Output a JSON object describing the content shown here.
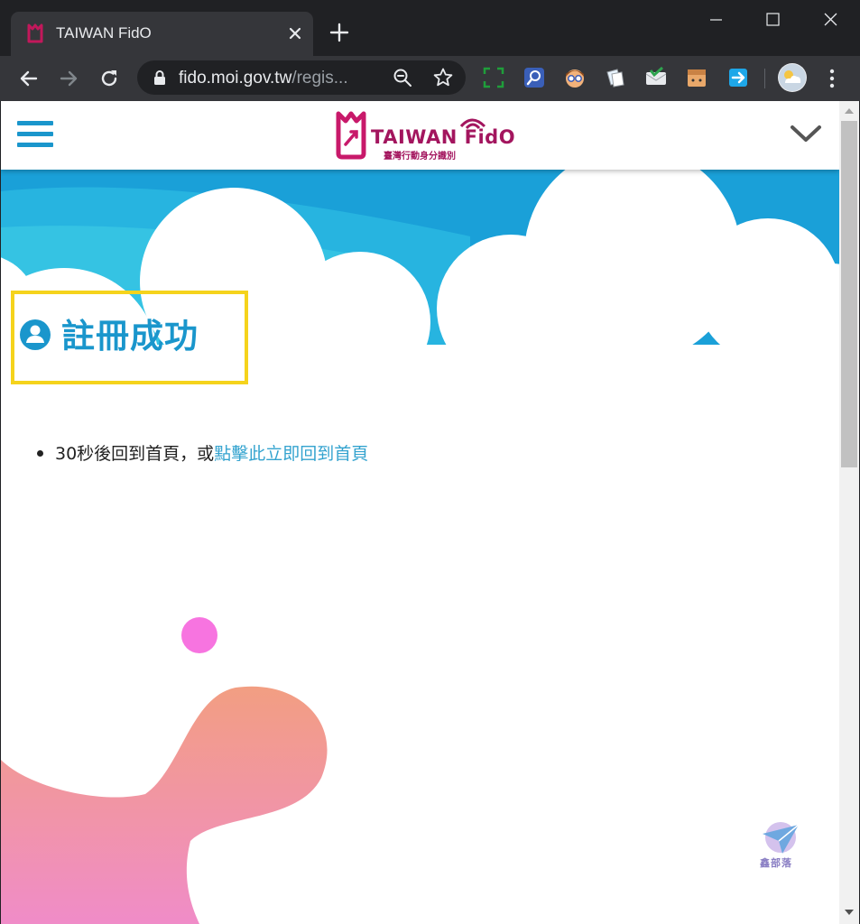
{
  "browser": {
    "tab": {
      "title": "TAIWAN FidO"
    },
    "url": {
      "host": "fido.moi.gov.tw",
      "path": "/regis..."
    },
    "extensions": [
      "screen-capture-extension-icon",
      "magnifier-extension-icon",
      "avatar-extension-icon",
      "notes-extension-icon",
      "mail-checker-extension-icon",
      "box-extension-icon",
      "send-extension-icon"
    ]
  },
  "site": {
    "logo": {
      "name": "TAIWAN FidO",
      "subtitle": "臺灣行動身分識別"
    }
  },
  "main": {
    "heading": "註冊成功",
    "message": {
      "text": "30秒後回到首頁，或",
      "link": "點擊此立即回到首頁"
    }
  },
  "watermark": {
    "text": "鑫部落"
  },
  "colors": {
    "accent": "#1a96cc",
    "brand": "#a3155e",
    "highlight_border": "#f5d31c",
    "link": "#34a3cf",
    "sky": "#1aa0d8",
    "blob": "#f29a86",
    "dot": "#f774e0"
  }
}
